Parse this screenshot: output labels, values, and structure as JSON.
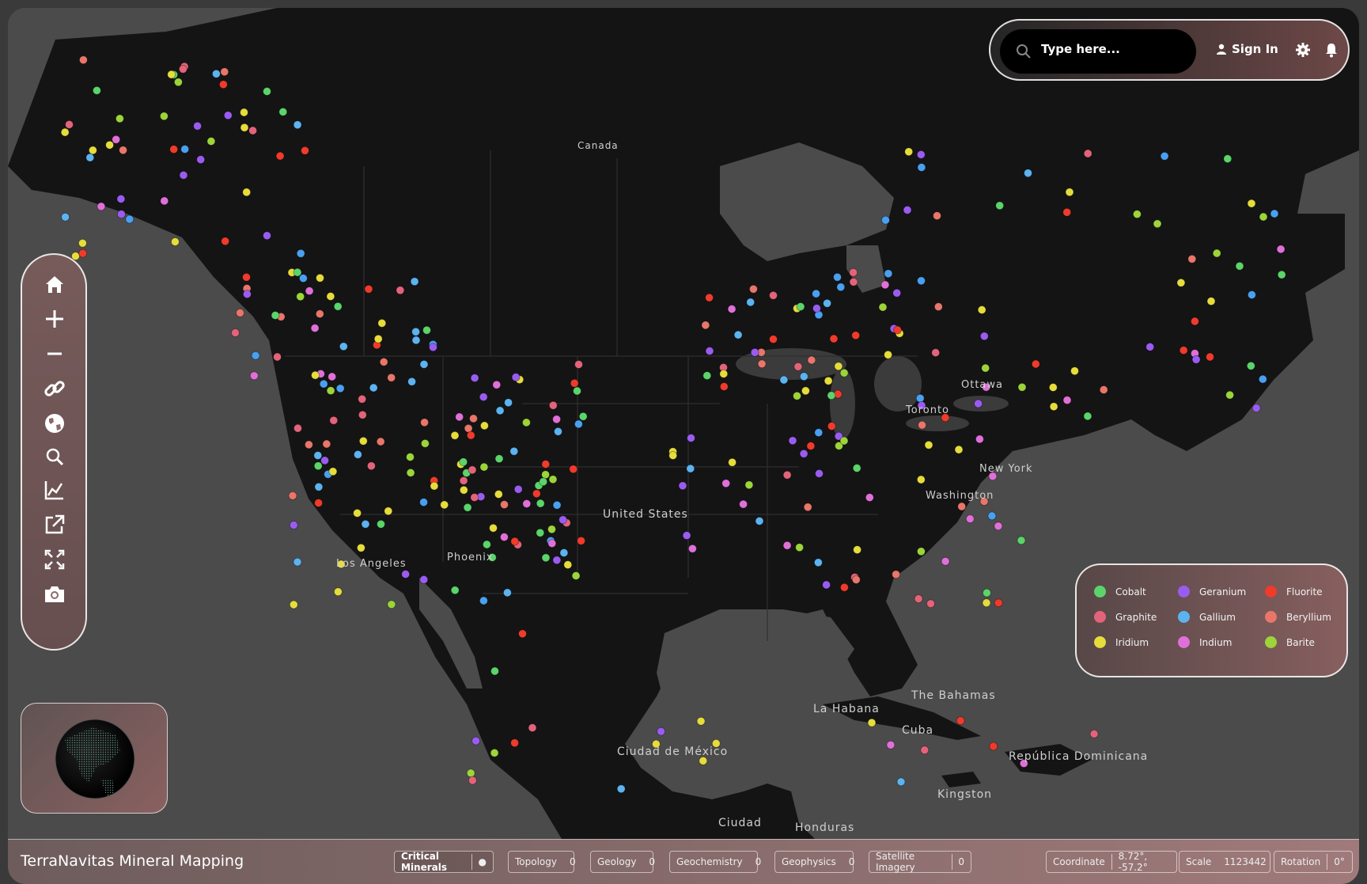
{
  "app": {
    "title": "TerraNavitas Mineral Mapping"
  },
  "search": {
    "placeholder": "Type here..."
  },
  "header": {
    "signin_label": "Sign In",
    "icons": [
      "search-icon",
      "user-icon",
      "gear-icon",
      "bell-icon"
    ]
  },
  "toolbar": {
    "tools": [
      "home-icon",
      "zoom-in-icon",
      "zoom-out-icon",
      "link-icon",
      "globe-icon",
      "search-icon",
      "chart-icon",
      "external-link-icon",
      "fullscreen-icon",
      "camera-icon"
    ]
  },
  "legend": {
    "items": [
      {
        "label": "Cobalt",
        "color": "#5bd46a"
      },
      {
        "label": "Geranium",
        "color": "#9a5cf0"
      },
      {
        "label": "Fluorite",
        "color": "#ef3b2c"
      },
      {
        "label": "Graphite",
        "color": "#e3647a"
      },
      {
        "label": "Gallium",
        "color": "#5cb3f0"
      },
      {
        "label": "Beryllium",
        "color": "#e8766a"
      },
      {
        "label": "Iridium",
        "color": "#e6dc3c"
      },
      {
        "label": "Indium",
        "color": "#e070d8"
      },
      {
        "label": "Barite",
        "color": "#9cd43a"
      }
    ]
  },
  "layers": [
    {
      "label": "Critical Minerals",
      "count": "●",
      "active": true
    },
    {
      "label": "Topology",
      "count": "0",
      "active": false
    },
    {
      "label": "Geology",
      "count": "0",
      "active": false
    },
    {
      "label": "Geochemistry",
      "count": "0",
      "active": false
    },
    {
      "label": "Geophysics",
      "count": "0",
      "active": false
    },
    {
      "label": "Satellite Imagery",
      "count": "0",
      "active": false
    }
  ],
  "status": {
    "coordinate_label": "Coordinate",
    "coordinate_value": "8.72°, -57.2°",
    "scale_label": "Scale",
    "scale_value": "1123442",
    "rotation_label": "Rotation",
    "rotation_value": "0°"
  },
  "map_labels": [
    "Canada",
    "Toronto",
    "Ottawa",
    "New York",
    "Washington",
    "United States",
    "Los Angeles",
    "Phoenix",
    "The Bahamas",
    "La Habana",
    "Cuba",
    "República Dominicana",
    "Kingston",
    "Ciudad de México",
    "Ciudad",
    "Honduras"
  ],
  "mineral_points": {
    "palette": [
      "#5bd46a",
      "#9a5cf0",
      "#ef3b2c",
      "#e3647a",
      "#5cb3f0",
      "#e8766a",
      "#e6dc3c",
      "#e070d8",
      "#9cd43a",
      "#4aa0f0",
      "#e6dc3c"
    ],
    "clusters": [
      {
        "region": "yukon-bc",
        "count": 48
      },
      {
        "region": "pacific-nw",
        "count": 40
      },
      {
        "region": "west-us",
        "count": 70
      },
      {
        "region": "rockies",
        "count": 40
      },
      {
        "region": "plains",
        "count": 20
      },
      {
        "region": "great-lakes",
        "count": 45
      },
      {
        "region": "quebec-maritimes",
        "count": 55
      },
      {
        "region": "appalachia",
        "count": 35
      },
      {
        "region": "mexico",
        "count": 14
      },
      {
        "region": "caribbean",
        "count": 8
      }
    ]
  }
}
